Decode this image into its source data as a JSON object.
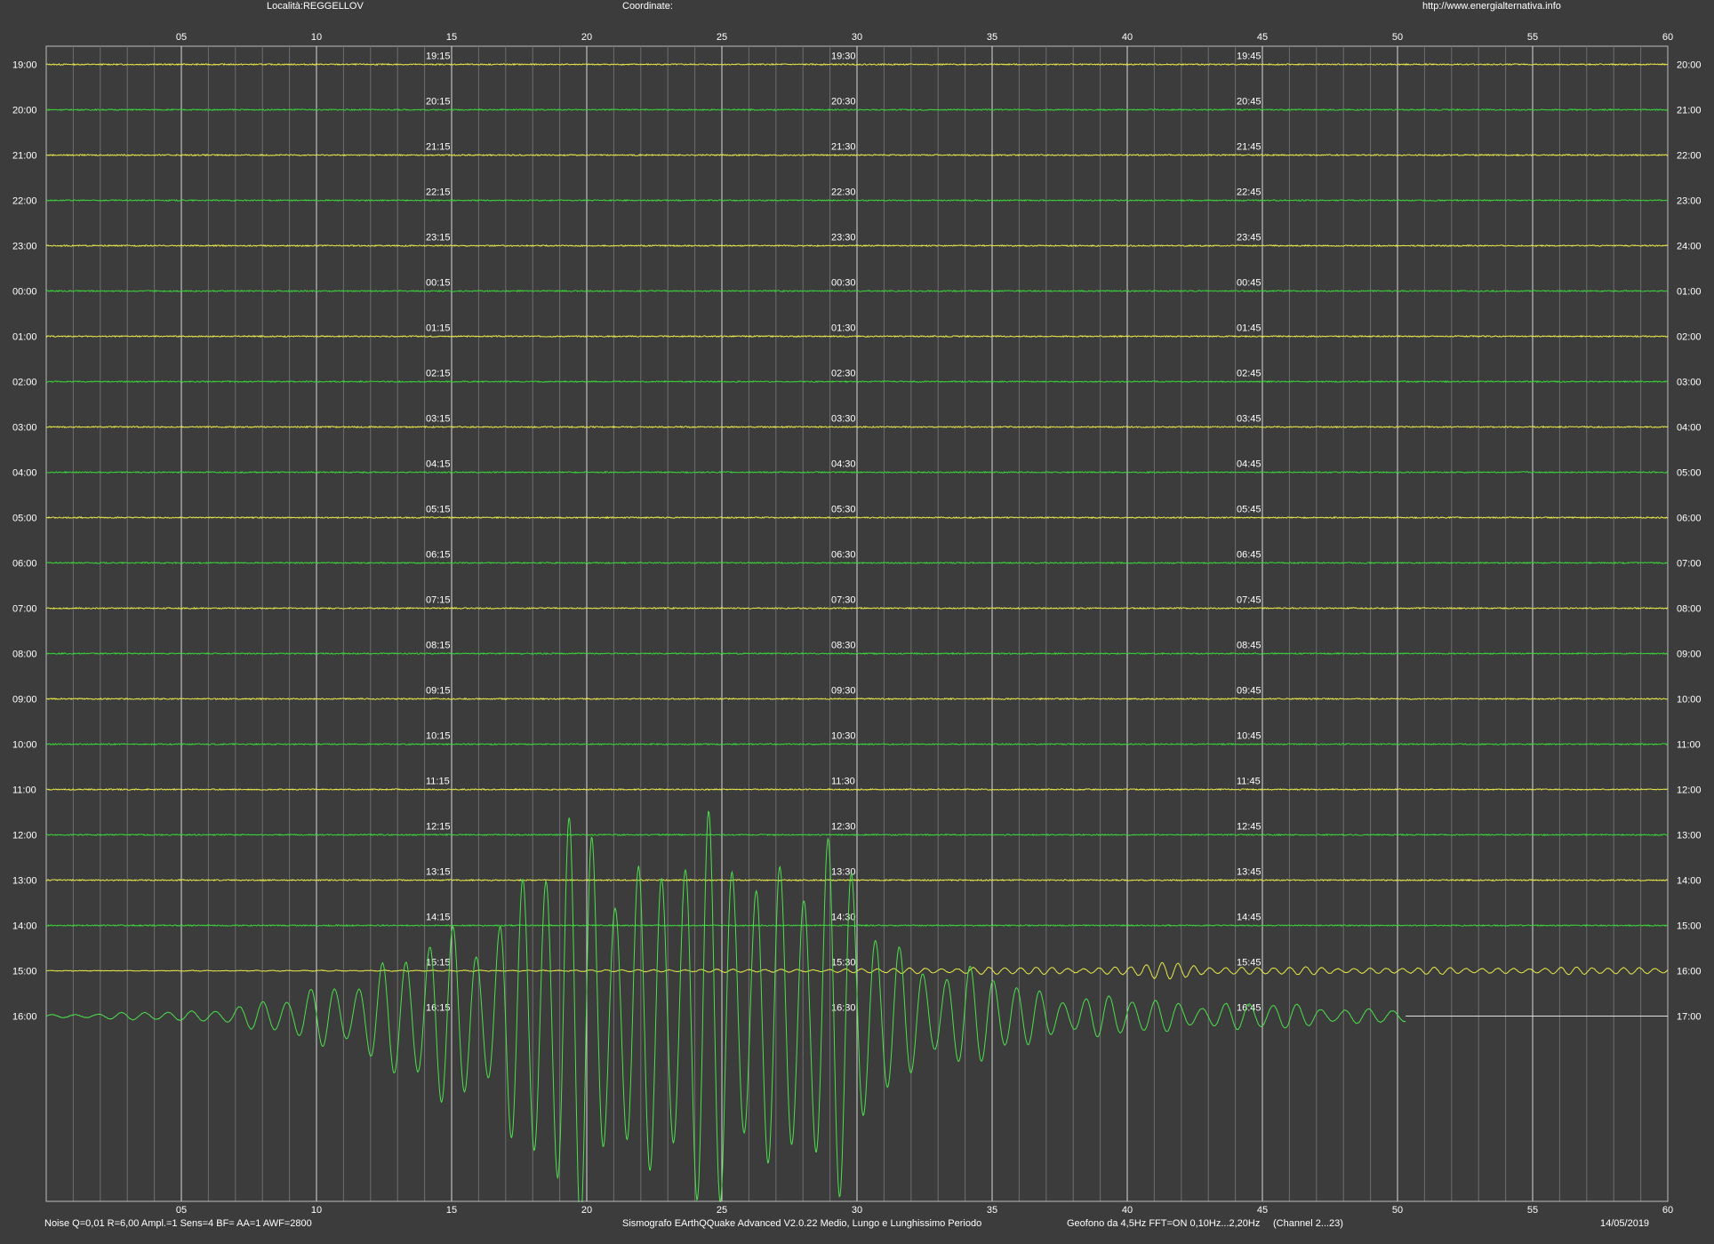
{
  "header": {
    "location": "Località:REGGELLOV",
    "coordinates": "Coordinate:",
    "website": "http://www.energialternativa.info"
  },
  "footer": {
    "settings": "Noise Q=0,01 R=6,00 Ampl.=1 Sens=4 BF= AA=1 AWF=2800",
    "software": "Sismografo  EArthQQuake Advanced V2.0.22  Medio, Lungo e Lunghissimo Periodo",
    "sensor": "Geofono da 4,5Hz FFT=ON 0,10Hz...2,20Hz",
    "channel": "(Channel 2...23)",
    "date": "14/05/2019"
  },
  "colors": {
    "background": "#3c3c3c",
    "yellow_trace": "#e8e84a",
    "green_trace": "#3ad43a",
    "event_trace": "#4ce04c",
    "grid": "#bdbdbd"
  },
  "chart_data": {
    "type": "line",
    "subtype": "helicorder",
    "xlim": [
      0,
      60
    ],
    "x_ticks": [
      "05",
      "10",
      "15",
      "20",
      "25",
      "30",
      "35",
      "40",
      "45",
      "50",
      "55",
      "60"
    ],
    "minor_tick_step_minutes": 1,
    "left_labels": [
      "19:00",
      "20:00",
      "21:00",
      "22:00",
      "23:00",
      "00:00",
      "01:00",
      "02:00",
      "03:00",
      "04:00",
      "05:00",
      "06:00",
      "07:00",
      "08:00",
      "09:00",
      "10:00",
      "11:00",
      "12:00",
      "13:00",
      "14:00",
      "15:00",
      "16:00"
    ],
    "right_labels": [
      "20:00",
      "21:00",
      "22:00",
      "23:00",
      "24:00",
      "01:00",
      "02:00",
      "03:00",
      "04:00",
      "05:00",
      "06:00",
      "07:00",
      "08:00",
      "09:00",
      "10:00",
      "11:00",
      "12:00",
      "13:00",
      "14:00",
      "15:00",
      "16:00",
      "17:00"
    ],
    "quarter_labels": [
      [
        "19:15",
        "19:30",
        "19:45"
      ],
      [
        "20:15",
        "20:30",
        "20:45"
      ],
      [
        "21:15",
        "21:30",
        "21:45"
      ],
      [
        "22:15",
        "22:30",
        "22:45"
      ],
      [
        "23:15",
        "23:30",
        "23:45"
      ],
      [
        "00:15",
        "00:30",
        "00:45"
      ],
      [
        "01:15",
        "01:30",
        "01:45"
      ],
      [
        "02:15",
        "02:30",
        "02:45"
      ],
      [
        "03:15",
        "03:30",
        "03:45"
      ],
      [
        "04:15",
        "04:30",
        "04:45"
      ],
      [
        "05:15",
        "05:30",
        "05:45"
      ],
      [
        "06:15",
        "06:30",
        "06:45"
      ],
      [
        "07:15",
        "07:30",
        "07:45"
      ],
      [
        "08:15",
        "08:30",
        "08:45"
      ],
      [
        "09:15",
        "09:30",
        "09:45"
      ],
      [
        "10:15",
        "10:30",
        "10:45"
      ],
      [
        "11:15",
        "11:30",
        "11:45"
      ],
      [
        "12:15",
        "12:30",
        "12:45"
      ],
      [
        "13:15",
        "13:30",
        "13:45"
      ],
      [
        "14:15",
        "14:30",
        "14:45"
      ],
      [
        "15:15",
        "15:30",
        "15:45"
      ],
      [
        "16:15",
        "16:30",
        "16:45"
      ]
    ],
    "trace_colors": [
      "yellow",
      "green",
      "yellow",
      "green",
      "yellow",
      "green",
      "yellow",
      "green",
      "yellow",
      "green",
      "yellow",
      "green",
      "yellow",
      "green",
      "yellow",
      "green",
      "yellow",
      "green",
      "yellow",
      "green",
      "yellow",
      "green"
    ],
    "quiet_noise": 0.7,
    "event": {
      "row_15_00": {
        "envelope": [
          [
            0,
            0.2
          ],
          [
            20,
            0.8
          ],
          [
            21,
            1.5
          ],
          [
            30,
            2.2
          ],
          [
            32,
            4
          ],
          [
            40,
            5
          ],
          [
            41,
            11
          ],
          [
            44,
            5
          ],
          [
            50,
            4
          ],
          [
            55,
            4
          ],
          [
            60,
            5
          ]
        ]
      },
      "row_16_00": {
        "end_minute": 50.3,
        "envelope": [
          [
            0,
            2
          ],
          [
            5,
            6
          ],
          [
            9,
            22
          ],
          [
            11,
            55
          ],
          [
            14,
            90
          ],
          [
            16.5,
            150
          ],
          [
            18,
            215
          ],
          [
            20,
            250
          ],
          [
            22,
            240
          ],
          [
            24,
            230
          ],
          [
            26,
            235
          ],
          [
            28,
            240
          ],
          [
            29,
            230
          ],
          [
            30,
            160
          ],
          [
            32,
            90
          ],
          [
            34,
            60
          ],
          [
            37,
            35
          ],
          [
            40,
            22
          ],
          [
            44,
            18
          ],
          [
            48,
            12
          ],
          [
            50.3,
            8
          ]
        ]
      }
    }
  }
}
